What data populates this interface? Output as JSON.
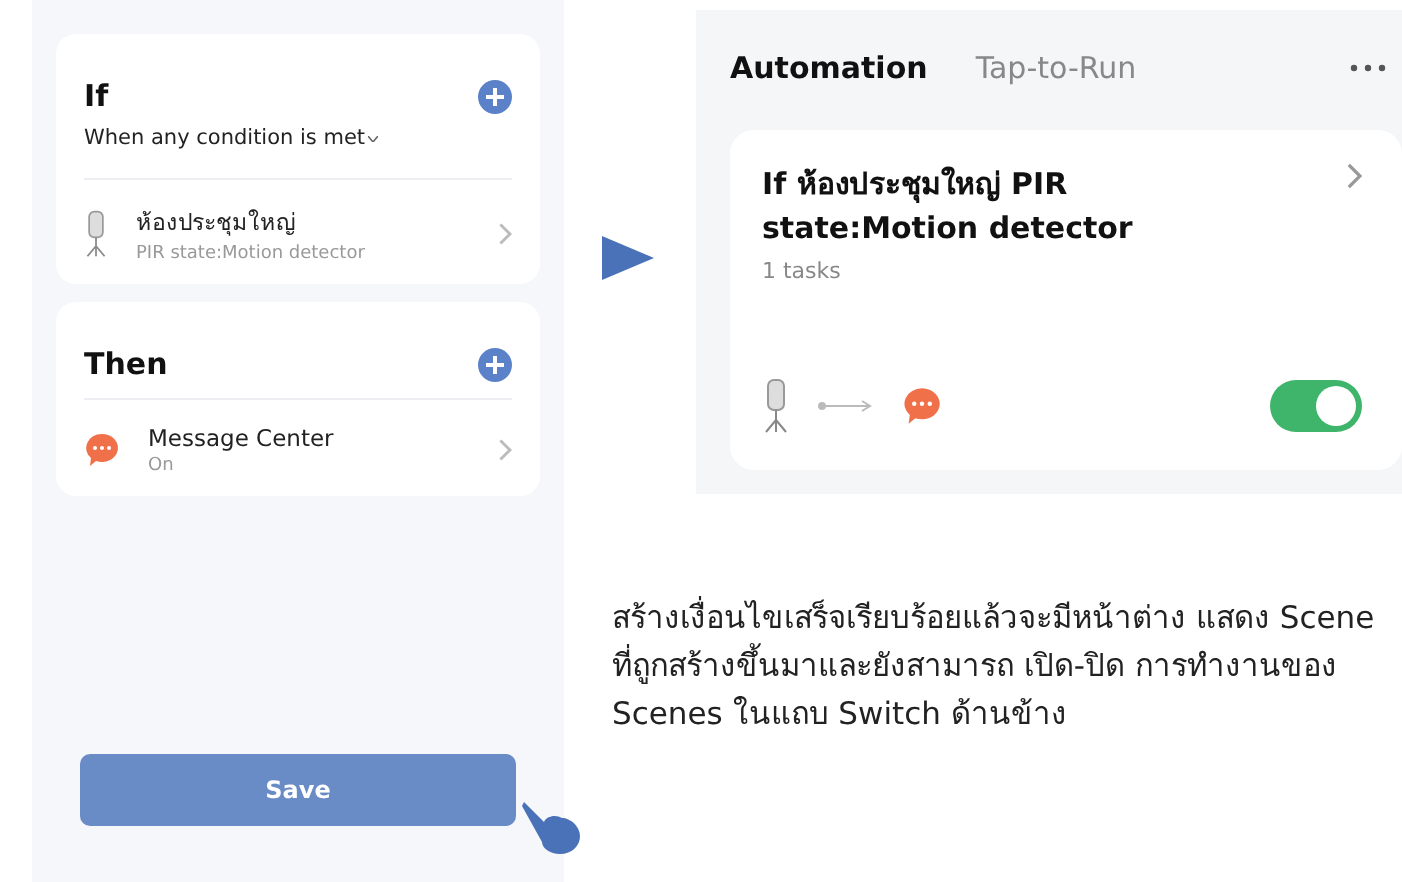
{
  "editor": {
    "if_section": {
      "title": "If",
      "condition_mode": "When any condition is met",
      "items": [
        {
          "kind": "sensor",
          "name": "ห้องประชุมใหญ่",
          "detail": "PIR state:Motion detector"
        }
      ]
    },
    "then_section": {
      "title": "Then",
      "items": [
        {
          "kind": "message",
          "name": "Message Center",
          "detail": "On"
        }
      ]
    },
    "save_button": "Save"
  },
  "scenes": {
    "tabs": [
      {
        "label": "Automation",
        "selected": true
      },
      {
        "label": "Tap-to-Run",
        "selected": false
      }
    ],
    "automations": [
      {
        "title": "If ห้องประชุมใหญ่ PIR state:Motion detector",
        "subtitle": "1 tasks",
        "on": true
      }
    ]
  },
  "caption": "สร้างเงื่อนไขเสร็จเรียบร้อยแล้วจะมีหน้าต่าง แสดง Scene ที่ถูกสร้างขึ้นมาและยังสามารถ เปิด-ปิด การทำงานของ Scenes ในแถบ Switch ด้านข้าง"
}
